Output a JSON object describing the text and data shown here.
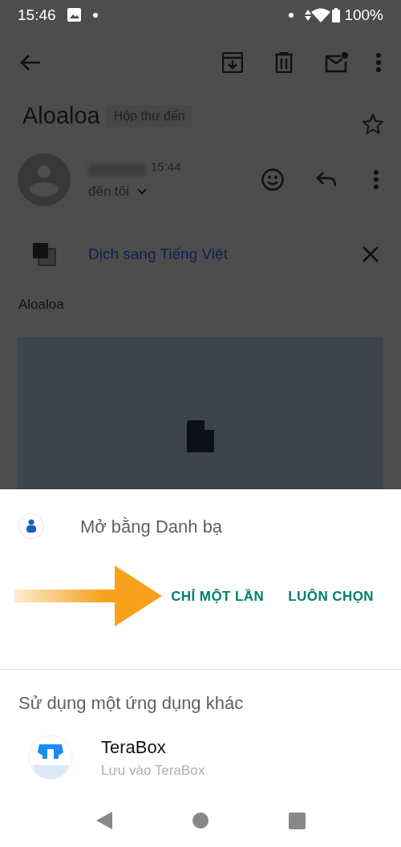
{
  "status_bar": {
    "time": "15:46",
    "battery": "100%"
  },
  "email": {
    "subject": "Aloaloa",
    "label": "Hộp thư đến",
    "starred": false,
    "time": "15:44",
    "recipient": "đến tôi",
    "translate": "Dịch sang Tiếng Việt",
    "body": "Aloaloa"
  },
  "sheet": {
    "title": "Mở bằng Danh bạ",
    "buttons": [
      "CHỈ MỘT LẦN",
      "LUÔN CHỌN"
    ],
    "section": "Sử dụng một ứng dụng khác",
    "apps": [
      {
        "name": "TeraBox",
        "subtitle": "Lưu vào TeraBox"
      }
    ]
  }
}
